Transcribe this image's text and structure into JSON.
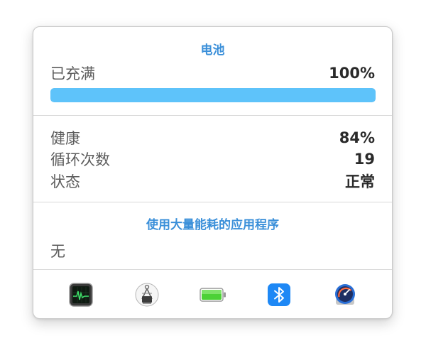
{
  "battery": {
    "title": "电池",
    "charge_label": "已充满",
    "charge_value": "100%",
    "charge_fraction": 1.0,
    "bar_color": "#5ec3fa"
  },
  "details": {
    "health_label": "健康",
    "health_value": "84%",
    "cycles_label": "循环次数",
    "cycles_value": "19",
    "status_label": "状态",
    "status_value": "正常"
  },
  "energy": {
    "title": "使用大量能耗的应用程序",
    "none_text": "无"
  },
  "dock": {
    "icons": [
      "activity-monitor-icon",
      "system-information-icon",
      "battery-icon",
      "bluetooth-icon",
      "istat-menus-icon"
    ]
  },
  "colors": {
    "accent": "#3a8fd9",
    "bluetooth": "#1e88f5"
  }
}
